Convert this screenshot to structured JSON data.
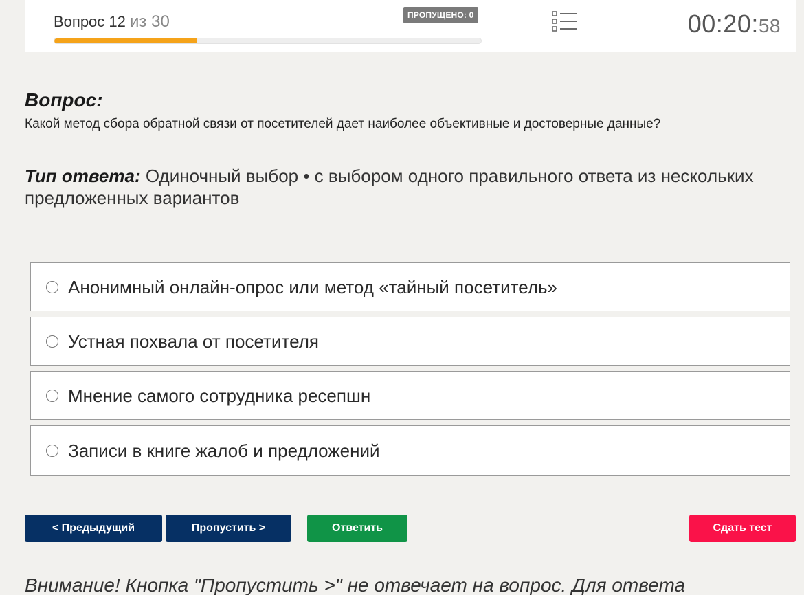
{
  "header": {
    "question_label": "Вопрос 12",
    "question_of": "из 30",
    "progress_fraction": 0.333,
    "skipped_badge": "ПРОПУЩЕНО: 0",
    "timer_main": "00:20:",
    "timer_seconds": "58",
    "progress_color": "#f5a31a"
  },
  "question": {
    "heading": "Вопрос:",
    "text": "Какой метод сбора обратной связи от посетителей дает наиболее объективные и достоверные данные?"
  },
  "answer_type": {
    "label": "Тип ответа:",
    "text": " Одиночный выбор • с выбором одного правильного ответа из нескольких предложенных вариантов"
  },
  "options": [
    {
      "label": "Анонимный онлайн-опрос или метод «тайный посетитель»"
    },
    {
      "label": "Устная похвала от посетителя"
    },
    {
      "label": "Мнение самого сотрудника ресепшн"
    },
    {
      "label": "Записи в книге жалоб и предложений"
    }
  ],
  "buttons": {
    "prev": "< Предыдущий",
    "skip": "Пропустить >",
    "answer": "Ответить",
    "submit": "Сдать тест"
  },
  "colors": {
    "nav_button": "#063064",
    "answer_button": "#109447",
    "submit_button": "#fa1249"
  },
  "warning": "Внимание! Кнопка \"Пропустить >\" не отвечает на вопрос. Для ответа"
}
